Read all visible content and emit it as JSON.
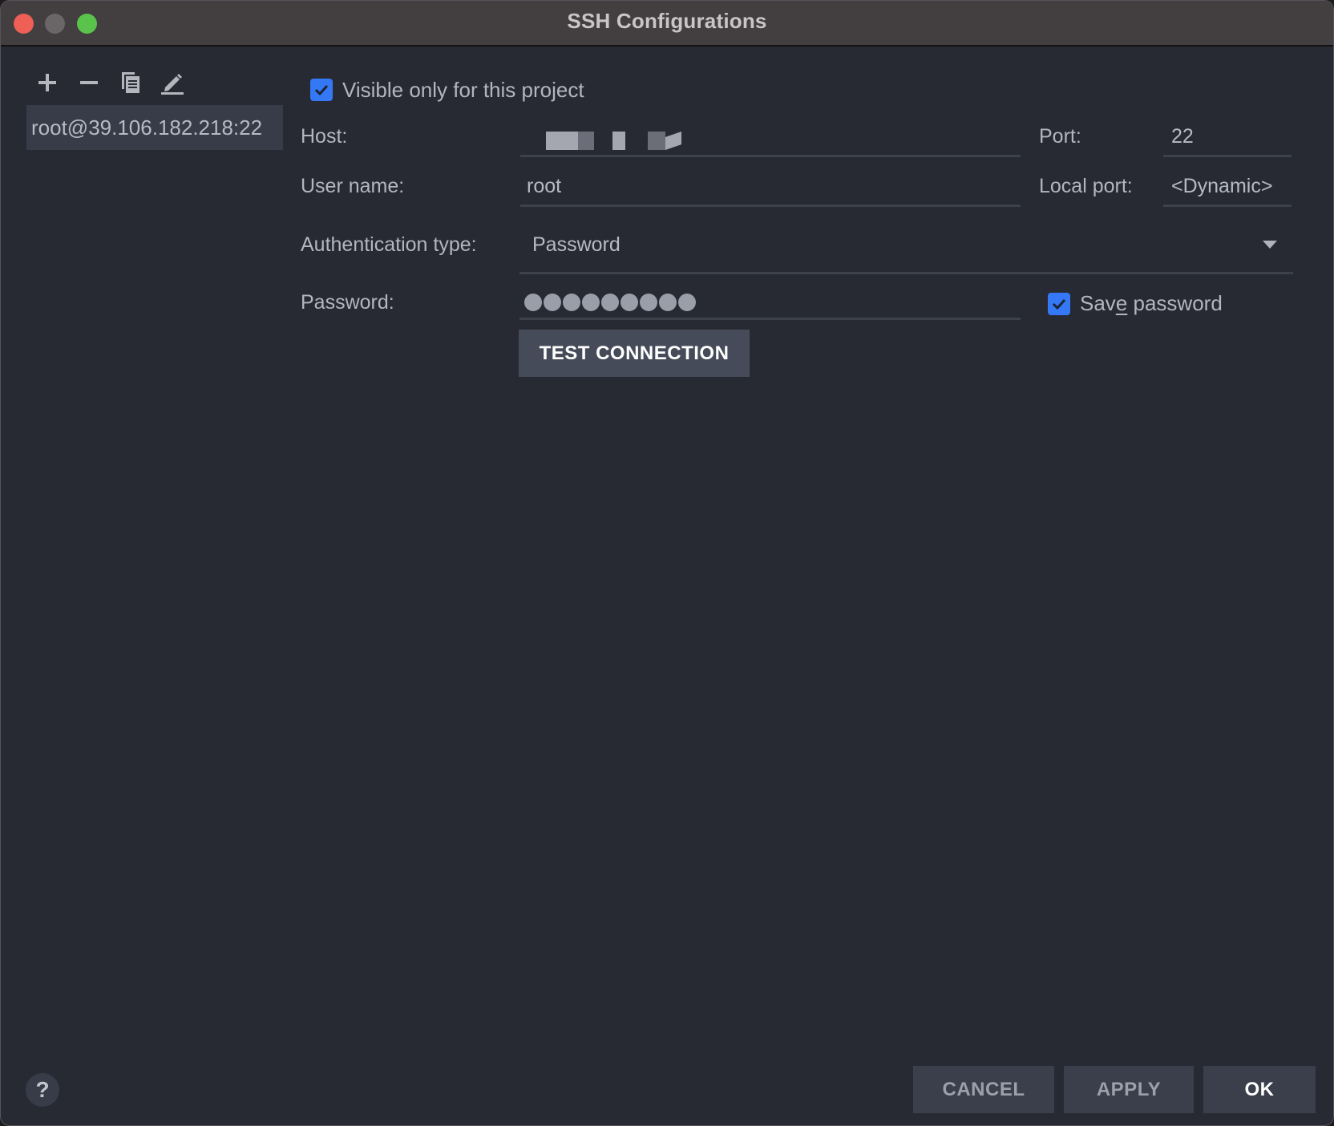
{
  "window": {
    "title": "SSH Configurations",
    "traffic_lights": [
      "close",
      "minimize",
      "maximize"
    ]
  },
  "toolbar": {
    "icons": [
      {
        "name": "add-icon",
        "glyph": "+"
      },
      {
        "name": "remove-icon",
        "glyph": "−"
      },
      {
        "name": "copy-icon",
        "glyph": "copy"
      },
      {
        "name": "edit-icon",
        "glyph": "pencil"
      }
    ]
  },
  "sidebar": {
    "items": [
      {
        "label": "root@39.106.182.218:22",
        "selected": true
      }
    ]
  },
  "form": {
    "visible_only": {
      "label": "Visible only for this project",
      "checked": true
    },
    "host": {
      "label": "Host:",
      "value": "[redacted]"
    },
    "port": {
      "label": "Port:",
      "value": "22"
    },
    "username": {
      "label": "User name:",
      "value": "root"
    },
    "local_port": {
      "label": "Local port:",
      "value": "<Dynamic>"
    },
    "auth_type": {
      "label": "Authentication type:",
      "value": "Password"
    },
    "password": {
      "label": "Password:",
      "masked_length": 9
    },
    "save_password": {
      "label_pre": "Sav",
      "label_mnemonic": "e",
      "label_post": " password",
      "checked": true
    },
    "test_connection_label": "TEST CONNECTION"
  },
  "footer": {
    "help_label": "?",
    "cancel_label": "CANCEL",
    "apply_label": "APPLY",
    "ok_label": "OK"
  },
  "colors": {
    "accent": "#3478f6",
    "background": "#272a33",
    "titlebar": "#433e40"
  }
}
